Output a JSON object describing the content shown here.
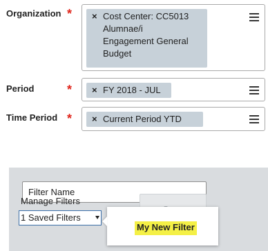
{
  "colors": {
    "required": "#e0251b",
    "pill_bg": "#c7d1d9",
    "panel_bg": "#d9dcdf",
    "highlight": "#f4f046"
  },
  "fields": [
    {
      "label": "Organization",
      "required": "*",
      "value_lines": [
        "Cost Center: CC5013",
        "Alumnae/i",
        "Engagement General",
        "Budget"
      ],
      "remove": "×",
      "icon": "list-menu-icon"
    },
    {
      "label": "Period",
      "required": "*",
      "value": "FY 2018 - JUL",
      "remove": "×",
      "icon": "list-menu-icon"
    },
    {
      "label": "Time Period",
      "required": "*",
      "value": "Current Period YTD",
      "remove": "×",
      "icon": "list-menu-icon"
    }
  ],
  "filter_panel": {
    "filter_name_value": "Filter Name",
    "manage_filters_label": "Manage Filters",
    "saved_filters_value": "1 Saved Filters",
    "save_label": "Save"
  },
  "dropdown": {
    "items": [
      "My New Filter"
    ]
  }
}
